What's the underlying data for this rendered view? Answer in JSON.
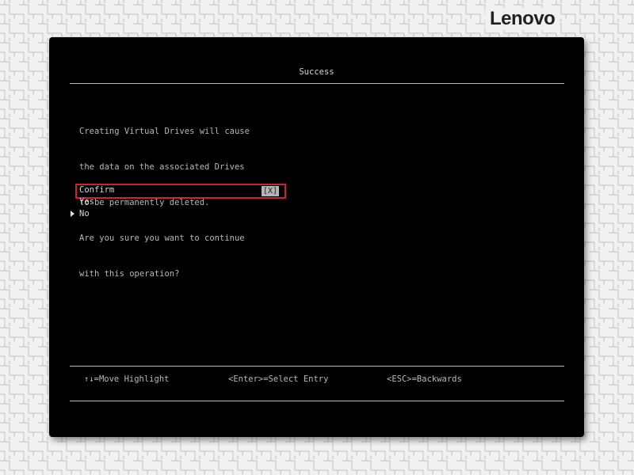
{
  "brand": {
    "logo_text": "Lenovo"
  },
  "dialog": {
    "title": "Success",
    "message_lines": [
      "Creating Virtual Drives will cause",
      "the data on the associated Drives",
      "to be permanently deleted.",
      "Are you sure you want to continue",
      "with this operation?"
    ],
    "options": {
      "confirm_label": "Confirm",
      "confirm_checkbox": "[X]",
      "yes_label": "Yes",
      "no_label": "No"
    },
    "selected_option": "No",
    "highlighted_option": "Confirm"
  },
  "footer": {
    "move": "↑↓=Move Highlight",
    "enter": "<Enter>=Select Entry",
    "esc": "<ESC>=Backwards"
  },
  "colors": {
    "window_bg": "#000000",
    "text": "#c8c8c8",
    "highlight_border": "#d0222a",
    "page_bg": "#f1f1f1"
  },
  "icons": [
    "selection-arrow-icon"
  ]
}
